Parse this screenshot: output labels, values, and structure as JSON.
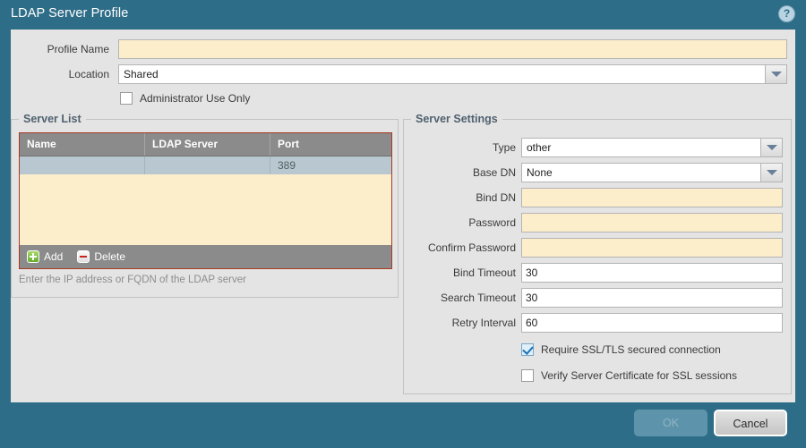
{
  "dialog": {
    "title": "LDAP Server Profile",
    "help_icon": "question-circle-icon"
  },
  "form": {
    "profile_name": {
      "label": "Profile Name",
      "value": "",
      "placeholder": ""
    },
    "location": {
      "label": "Location",
      "value": "Shared",
      "options": [
        "Shared"
      ]
    },
    "admin_use_only": {
      "label": "Administrator Use Only",
      "checked": false
    }
  },
  "server_list": {
    "legend": "Server List",
    "columns": [
      "Name",
      "LDAP Server",
      "Port"
    ],
    "rows": [
      {
        "name": "",
        "ldap_server": "",
        "port": "389",
        "error": true
      }
    ],
    "add_label": "Add",
    "delete_label": "Delete",
    "add_icon": "plus-square-icon",
    "delete_icon": "minus-square-icon",
    "hint": "Enter the IP address or FQDN of the LDAP server"
  },
  "server_settings": {
    "legend": "Server Settings",
    "type": {
      "label": "Type",
      "value": "other",
      "options": [
        "other"
      ]
    },
    "base_dn": {
      "label": "Base DN",
      "value": "None",
      "options": [
        "None"
      ]
    },
    "bind_dn": {
      "label": "Bind DN",
      "value": "",
      "placeholder": ""
    },
    "password": {
      "label": "Password",
      "value": "",
      "placeholder": ""
    },
    "confirm_password": {
      "label": "Confirm Password",
      "value": "",
      "placeholder": ""
    },
    "bind_timeout": {
      "label": "Bind Timeout",
      "value": "30"
    },
    "search_timeout": {
      "label": "Search Timeout",
      "value": "30"
    },
    "retry_interval": {
      "label": "Retry Interval",
      "value": "60"
    },
    "require_ssl": {
      "label": "Require SSL/TLS secured connection",
      "checked": true
    },
    "verify_cert": {
      "label": "Verify Server Certificate for SSL sessions",
      "checked": false
    }
  },
  "footer": {
    "ok_label": "OK",
    "cancel_label": "Cancel"
  },
  "colors": {
    "title_bar": "#2e6d87",
    "content_bg": "#e4e4e4",
    "required_field": "#fdeecb",
    "error_border": "#a83a21",
    "table_header": "#8b8b8b",
    "table_row": "#b9c8d0",
    "legend_text": "#50616f"
  }
}
